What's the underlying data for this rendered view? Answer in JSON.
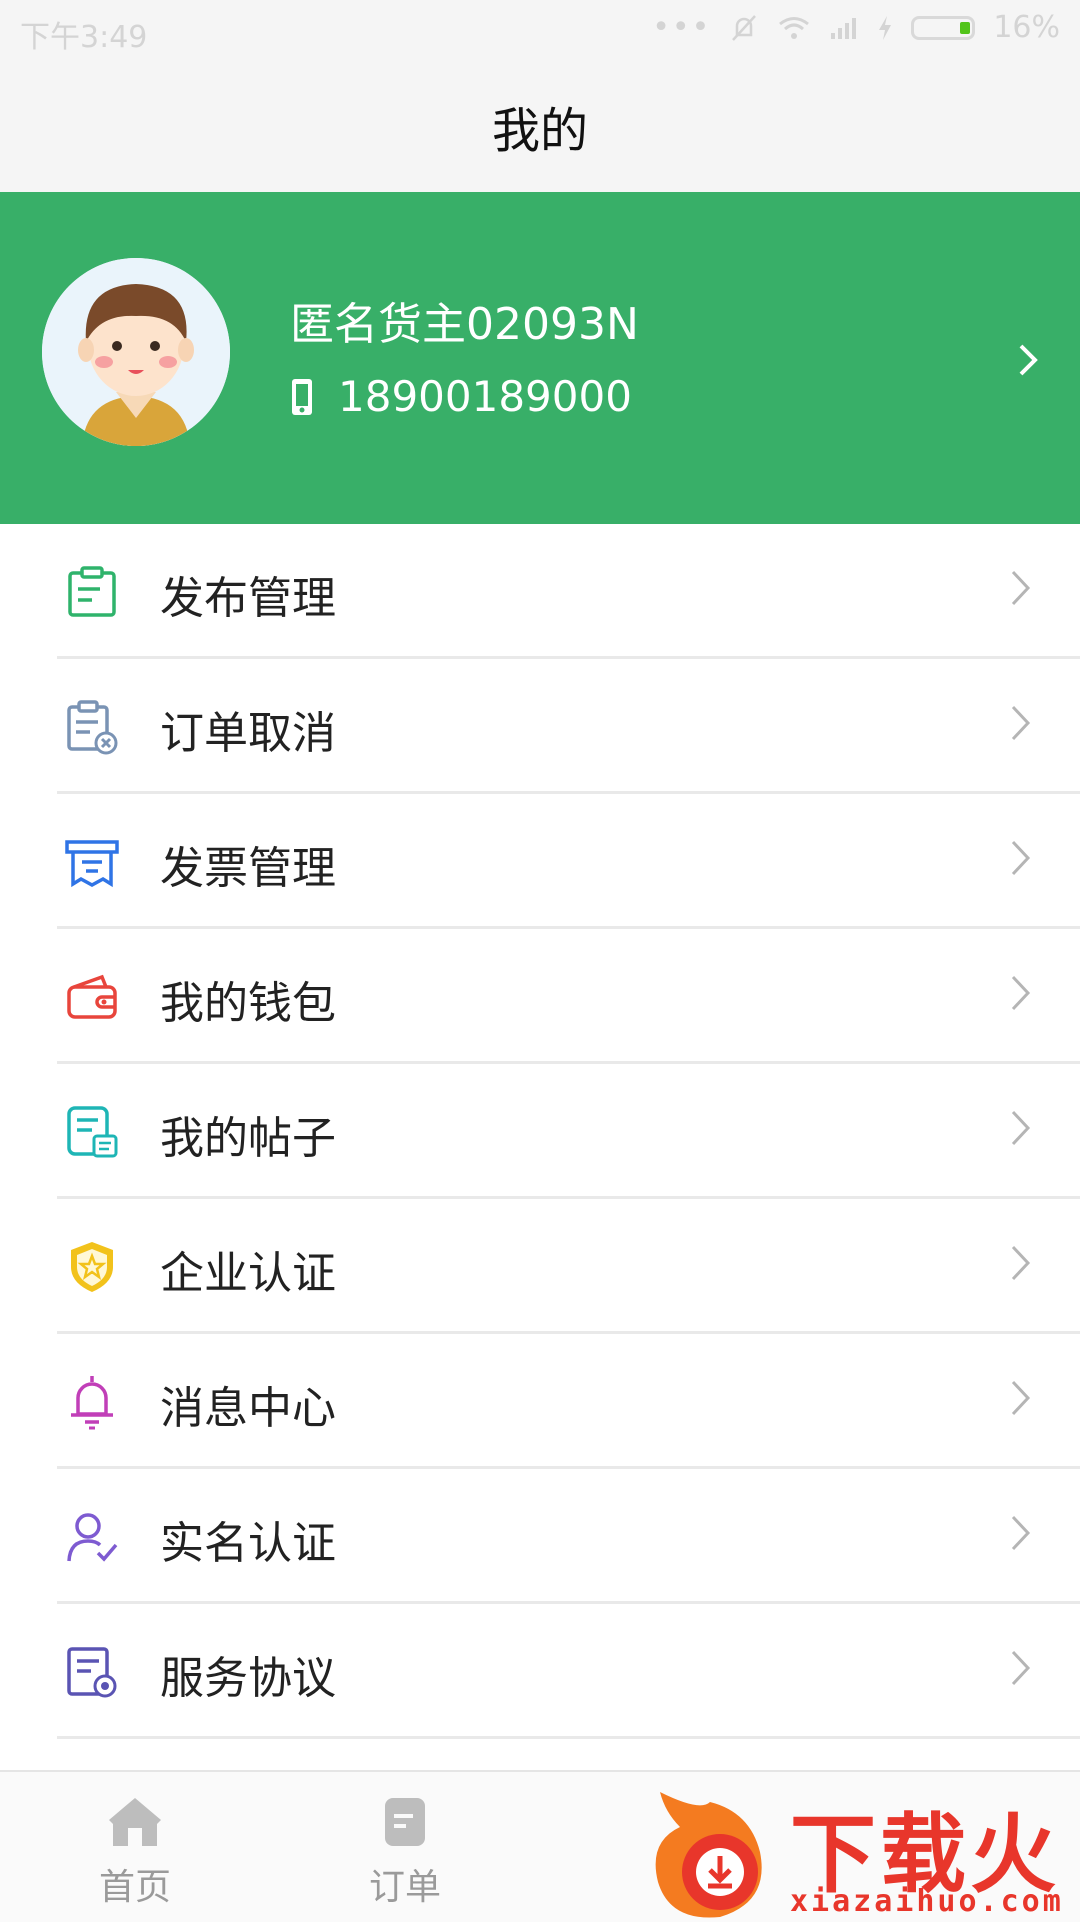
{
  "status_bar": {
    "time": "下午3:49",
    "battery": "16%",
    "battery_level_percent": 16
  },
  "nav": {
    "title": "我的"
  },
  "profile": {
    "name": "匿名货主02093N",
    "phone": "18900189000"
  },
  "menu": [
    {
      "id": "publish",
      "label": "发布管理",
      "icon": "clipboard-icon",
      "color": "#2fb36b"
    },
    {
      "id": "order-cancel",
      "label": "订单取消",
      "icon": "clipboard-cancel-icon",
      "color": "#7a93b4"
    },
    {
      "id": "invoice",
      "label": "发票管理",
      "icon": "invoice-icon",
      "color": "#2f74e6"
    },
    {
      "id": "wallet",
      "label": "我的钱包",
      "icon": "wallet-icon",
      "color": "#e8453c"
    },
    {
      "id": "posts",
      "label": "我的帖子",
      "icon": "post-icon",
      "color": "#1eb5b5"
    },
    {
      "id": "enterprise",
      "label": "企业认证",
      "icon": "shield-star-icon",
      "color": "#f2c21b"
    },
    {
      "id": "messages",
      "label": "消息中心",
      "icon": "bell-icon",
      "color": "#c13fb8"
    },
    {
      "id": "realname",
      "label": "实名认证",
      "icon": "user-check-icon",
      "color": "#7e5bd1"
    },
    {
      "id": "agreement",
      "label": "服务协议",
      "icon": "document-icon",
      "color": "#5a54b3"
    }
  ],
  "tabbar": [
    {
      "label": "首页",
      "icon": "home-icon"
    },
    {
      "label": "订单",
      "icon": "order-icon"
    }
  ],
  "watermark": {
    "brand": "下载火",
    "url": "xiazaihuo.com"
  },
  "colors": {
    "accent": "#38af68",
    "chevron": "#b5b5b5"
  }
}
